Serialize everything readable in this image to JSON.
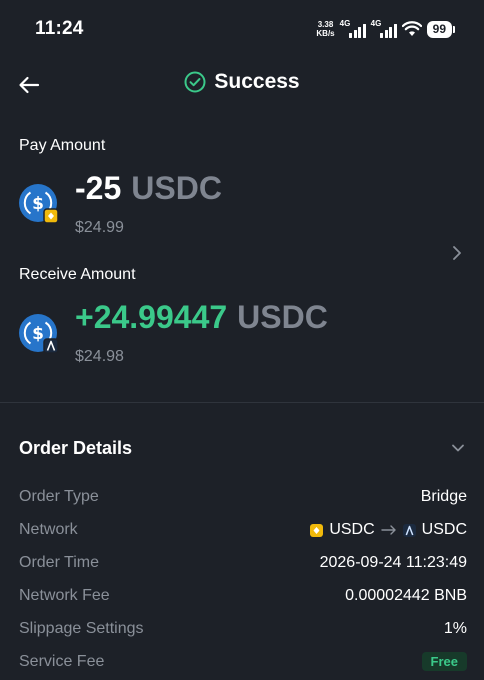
{
  "status_bar": {
    "time": "11:24",
    "net_speed_value": "3.38",
    "net_speed_unit": "KB/s",
    "sim1_label": "4G",
    "sim2_label": "4G",
    "battery": "99"
  },
  "header": {
    "title": "Success",
    "back_icon": "arrow-left-icon",
    "status_icon": "check-circle-icon"
  },
  "pay": {
    "label": "Pay Amount",
    "amount": "-25",
    "unit": "USDC",
    "usd_value": "$24.99",
    "chain_badge": "bnb-chain-badge"
  },
  "receive": {
    "label": "Receive Amount",
    "amount": "+24.99447",
    "unit": "USDC",
    "usd_value": "$24.98",
    "chain_badge": "arbitrum-badge"
  },
  "order_details": {
    "title": "Order Details",
    "rows": [
      {
        "label": "Order Type",
        "value": "Bridge"
      },
      {
        "label": "Network",
        "from_token": "USDC",
        "to_token": "USDC"
      },
      {
        "label": "Order Time",
        "value": "2026-09-24 11:23:49"
      },
      {
        "label": "Network Fee",
        "value": "0.00002442 BNB"
      },
      {
        "label": "Slippage Settings",
        "value": "1%"
      },
      {
        "label": "Service Fee",
        "value": "Free"
      }
    ]
  },
  "colors": {
    "background": "#1d2128",
    "positive": "#3bc98a",
    "usdc_blue": "#2775ca",
    "bnb_yellow": "#f0b90b",
    "muted_text": "#8a9099"
  }
}
